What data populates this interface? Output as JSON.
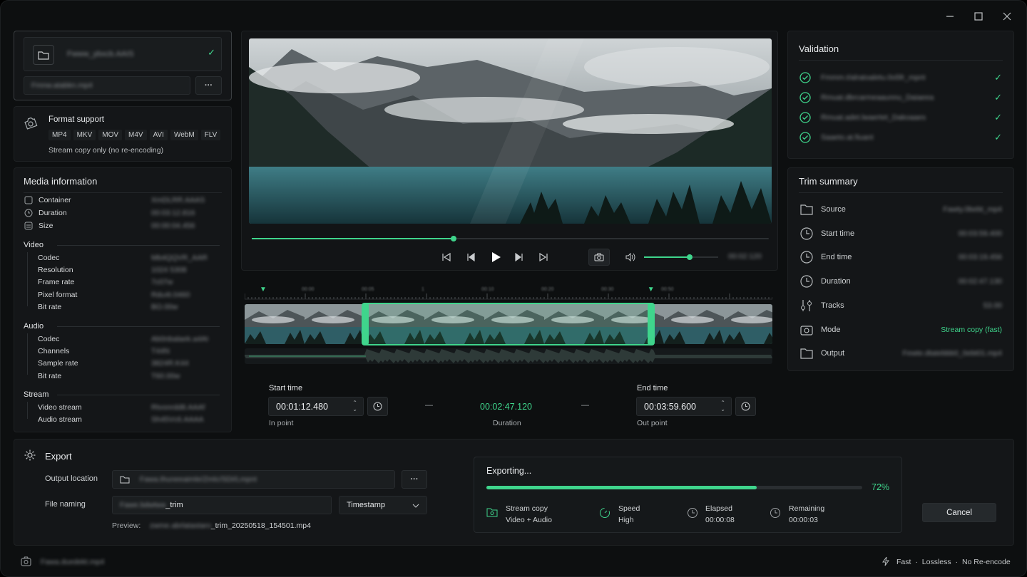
{
  "window": {
    "minimize_icon": "minimize-icon",
    "maximize_icon": "maximize-icon",
    "close_icon": "close-icon"
  },
  "source": {
    "file_name": "Fwww_ybxcb.AAIS",
    "path": "Fmnw.atabkn.mp4",
    "more_label": "···"
  },
  "format_support": {
    "title": "Format support",
    "formats": [
      "MP4",
      "MKV",
      "MOV",
      "M4V",
      "AVI",
      "WebM",
      "FLV"
    ],
    "note": "Stream copy only (no re-encoding)"
  },
  "media_info": {
    "title": "Media information",
    "general": [
      {
        "label": "Container",
        "value": "XmDLRR.AAAS"
      },
      {
        "label": "Duration",
        "value": "00:03:12.816"
      },
      {
        "label": "Size",
        "value": "00:00:04.456"
      }
    ],
    "video_header": "Video",
    "video": [
      {
        "label": "Codec",
        "value": "Mb4QQVR_AAR"
      },
      {
        "label": "Resolution",
        "value": "1024 5308"
      },
      {
        "label": "Frame rate",
        "value": "7c07w"
      },
      {
        "label": "Pixel format",
        "value": "Rdu4t.0460"
      },
      {
        "label": "Bit rate",
        "value": "BO.00w"
      }
    ],
    "audio_header": "Audio",
    "audio": [
      {
        "label": "Codec",
        "value": "Ab0nbalaek.a4At"
      },
      {
        "label": "Channels",
        "value": "T44N"
      },
      {
        "label": "Sample rate",
        "value": "3824R.K44"
      },
      {
        "label": "Bit rate",
        "value": "T60.00w"
      }
    ],
    "stream_header": "Stream",
    "stream": [
      {
        "label": "Video stream",
        "value": "Rtvonrdd8.AAAf"
      },
      {
        "label": "Audio stream",
        "value": "Sh45Vc6.AAAA"
      }
    ]
  },
  "player": {
    "time": "00:02:120",
    "progress": 0.39,
    "volume": 0.62
  },
  "timeline": {
    "ticks": [
      "00:00",
      "00:05",
      "1",
      "00:10",
      "00:20",
      "00:30",
      "00:50"
    ],
    "selection_start": 0.228,
    "selection_end": 0.77
  },
  "trim": {
    "start_label": "Start time",
    "start_value": "00:01:12.480",
    "in_label": "In point",
    "duration_value": "00:02:47.120",
    "duration_label": "Duration",
    "end_label": "End time",
    "end_value": "00:03:59.600",
    "out_label": "Out point",
    "dash": "—"
  },
  "validation": {
    "title": "Validation",
    "items": [
      "Fmmm.t/alratoaletu.0o5fr_mpnt",
      "Rmuat.dbrcarmeaaunnu_Daiaeea",
      "Rmuat.adet.lwaertet_Dakoaaes",
      "Saaeto.at.fiuant"
    ]
  },
  "summary": {
    "title": "Trim summary",
    "rows": [
      {
        "icon": "folder-icon",
        "label": "Source",
        "value": "Fawty.0bebt_mp4",
        "green": false
      },
      {
        "icon": "clock-icon",
        "label": "Start time",
        "value": "00:03:59.400",
        "green": false
      },
      {
        "icon": "clock-icon",
        "label": "End time",
        "value": "00:03:19.456",
        "green": false
      },
      {
        "icon": "clock-icon",
        "label": "Duration",
        "value": "00:02:47.130",
        "green": false
      },
      {
        "icon": "tracks-icon",
        "label": "Tracks",
        "value": "53.00",
        "green": false
      },
      {
        "icon": "camera-icon",
        "label": "Mode",
        "value": "Stream copy (fast)",
        "green": true
      },
      {
        "icon": "folder-icon",
        "label": "Output",
        "value": "Fewte.dtatebbb0_0ebt01.mp4",
        "green": false
      }
    ]
  },
  "export": {
    "title": "Export",
    "output_label": "Output location",
    "output_value": "Fawa.thuneeaimle/Zmlc/SDI/Lmpnt",
    "naming_label": "File naming",
    "naming_prefix": "Fawe.bdwtwa",
    "naming_suffix": "_trim",
    "naming_option": "Timestamp",
    "preview_label": "Preview:",
    "preview_prefix": "zwme.abrlatastaro",
    "preview_suffix": "_trim_20250518_154501.mp4",
    "more_label": "···"
  },
  "progress": {
    "title": "Exporting...",
    "percent_text": "72%",
    "fraction": 0.72,
    "stats": [
      {
        "label": "Stream copy",
        "value": "Video + Audio"
      },
      {
        "label": "Speed",
        "value": "High"
      },
      {
        "label": "Elapsed",
        "value": "00:00:08"
      },
      {
        "label": "Remaining",
        "value": "00:00:03"
      }
    ],
    "cancel_label": "Cancel"
  },
  "statusbar": {
    "file": "Fawa.duedekt.mp4",
    "fast": "Fast",
    "lossless": "Lossless",
    "no_reencode": "No Re-encode",
    "dot": "·"
  },
  "colors": {
    "accent": "#3fd58c",
    "panel": "#141618",
    "bg": "#0d0f10"
  }
}
